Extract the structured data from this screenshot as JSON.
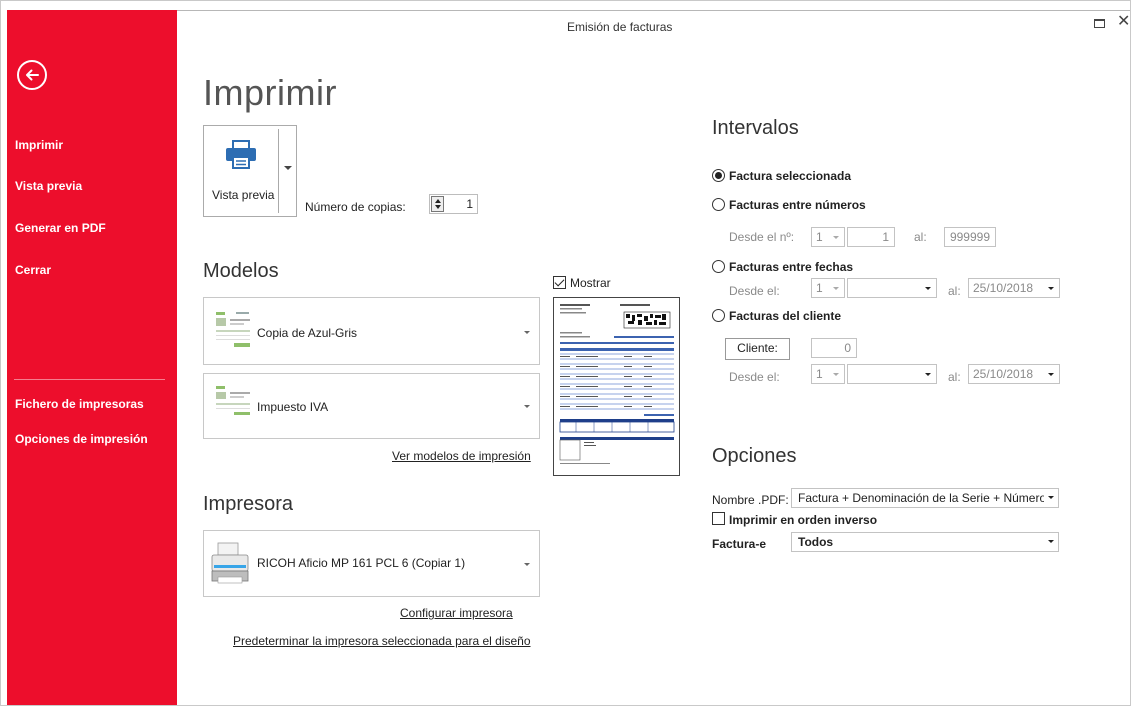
{
  "window": {
    "title": "Emisión de facturas"
  },
  "sidebar": {
    "back_icon": "back-arrow-icon",
    "items": [
      {
        "label": "Imprimir"
      },
      {
        "label": "Vista previa"
      },
      {
        "label": "Generar en PDF"
      },
      {
        "label": "Cerrar"
      },
      {
        "label": "Fichero de impresoras"
      },
      {
        "label": "Opciones de impresión"
      }
    ],
    "color": "#ed0e2c"
  },
  "main": {
    "title": "Imprimir",
    "print_button_label": "Vista previa",
    "copies_label": "Número de copias:",
    "copies_value": "1",
    "models_heading": "Modelos",
    "models": [
      {
        "label": "Copia de Azul-Gris"
      },
      {
        "label": "Impuesto IVA"
      }
    ],
    "models_link": "Ver modelos de impresión",
    "show_label": "Mostrar",
    "printer_heading": "Impresora",
    "printer_name": "RICOH Aficio MP 161 PCL 6 (Copiar 1)",
    "configure_link": "Configurar impresora",
    "default_link": "Predeterminar la impresora seleccionada para el diseño"
  },
  "intervals": {
    "heading": "Intervalos",
    "opt_selected": "Factura seleccionada",
    "opt_numbers": "Facturas entre números",
    "from_no_label": "Desde el nº:",
    "from_series": "1",
    "from_number": "1",
    "to_label": "al:",
    "to_number": "999999",
    "opt_dates": "Facturas entre fechas",
    "from_label": "Desde el:",
    "dates_series": "1",
    "dates_to": "25/10/2018",
    "opt_client": "Facturas del cliente",
    "client_button": "Cliente:",
    "client_value": "0",
    "client_series": "1",
    "client_to": "25/10/2018"
  },
  "options": {
    "heading": "Opciones",
    "pdf_label": "Nombre .PDF:",
    "pdf_value": "Factura + Denominación de la Serie + Número",
    "reverse_label": "Imprimir en orden inverso",
    "efactura_label": "Factura-e",
    "efactura_value": "Todos"
  }
}
